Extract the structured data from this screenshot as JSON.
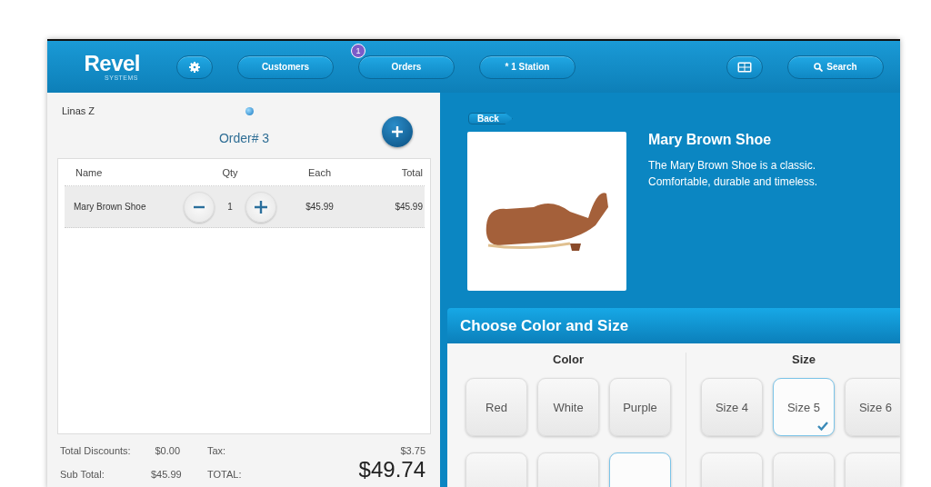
{
  "topbar": {
    "logo": "Revel",
    "logo_sub": "SYSTEMS",
    "buttons": [
      {
        "kind": "settings"
      },
      {
        "kind": "text",
        "label": "Customers"
      },
      {
        "kind": "text",
        "label": "Orders",
        "badge": "1"
      },
      {
        "kind": "text",
        "label": "* 1 Station"
      },
      {
        "kind": "spacer"
      },
      {
        "kind": "grid"
      },
      {
        "kind": "search",
        "label": "Search"
      }
    ]
  },
  "order": {
    "customer": "Linas Z",
    "title": "Order# 3",
    "columns": [
      "Name",
      "Qty",
      "Each",
      "Total"
    ],
    "rows": [
      {
        "name": "Mary Brown Shoe",
        "qty": "1",
        "each": "$45.99",
        "total": "$45.99",
        "selected": true
      }
    ],
    "totals": {
      "discounts_label": "Total Discounts:",
      "discounts": "$0.00",
      "tax_label": "Tax:",
      "tax": "$3.75",
      "subtotal_label": "Sub Total:",
      "subtotal": "$45.99",
      "total_label": "TOTAL:",
      "total": "$49.74"
    }
  },
  "product": {
    "back": "Back",
    "name": "Mary Brown Shoe",
    "description": "The Mary Brown Shoe is a classic. Comfortable, durable and timeless."
  },
  "options": {
    "title": "Choose Color and Size",
    "groups": [
      {
        "heading": "Color",
        "items": [
          {
            "label": "Red",
            "selected": false
          },
          {
            "label": "White",
            "selected": false
          },
          {
            "label": "Purple",
            "selected": false
          },
          {
            "selected": false
          },
          {
            "selected": false
          },
          {
            "selected": true
          }
        ]
      },
      {
        "heading": "Size",
        "items": [
          {
            "label": "Size 4",
            "selected": false
          },
          {
            "label": "Size 5",
            "selected": true
          },
          {
            "label": "Size 6",
            "selected": false
          },
          {
            "selected": false
          },
          {
            "selected": false
          },
          {
            "selected": false
          }
        ]
      }
    ]
  }
}
